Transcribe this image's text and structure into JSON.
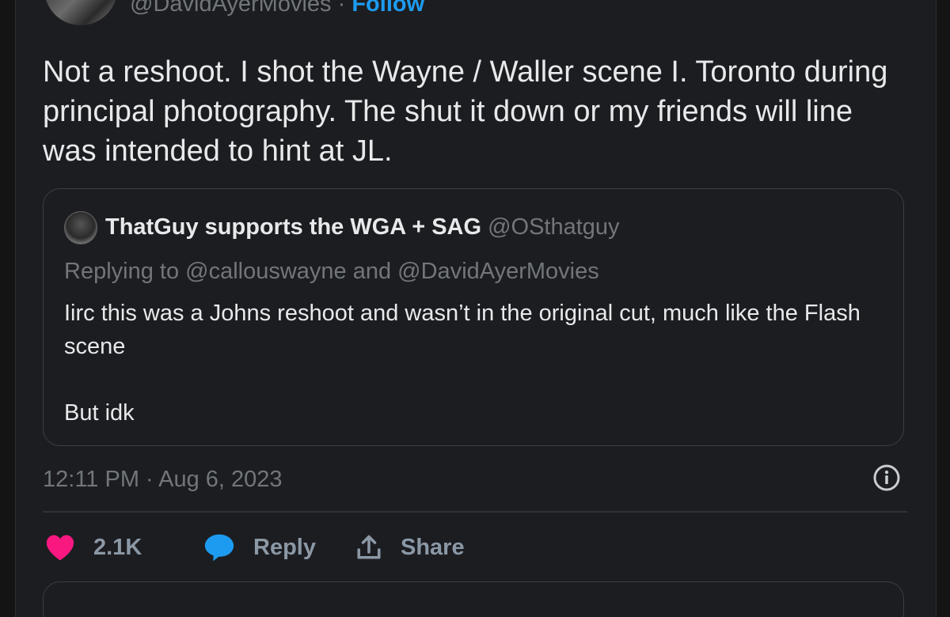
{
  "header": {
    "handle": "@DavidAyerMovies",
    "separator": "·",
    "follow_label": "Follow"
  },
  "tweet": {
    "text": "Not a reshoot. I shot the Wayne / Waller scene I. Toronto during principal photography. The shut it down or my friends will line was intended to hint at JL."
  },
  "quote": {
    "display_name": "ThatGuy supports the WGA + SAG",
    "handle": "@OSthatguy",
    "replying_to": "Replying to @callouswayne and @DavidAyerMovies",
    "body": "Iirc this was a Johns reshoot and wasn’t in the original cut, much like the Flash scene\n\nBut idk"
  },
  "meta": {
    "timestamp": "12:11 PM · Aug 6, 2023"
  },
  "actions": {
    "like_count": "2.1K",
    "reply_label": "Reply",
    "share_label": "Share"
  },
  "colors": {
    "background": "#1c1d21",
    "accent": "#1d9bf0",
    "like": "#f91880",
    "text": "#e7e9ea",
    "muted": "#71767b"
  },
  "icons": [
    "avatar",
    "info-icon",
    "heart-icon",
    "reply-bubble-icon",
    "share-icon"
  ]
}
